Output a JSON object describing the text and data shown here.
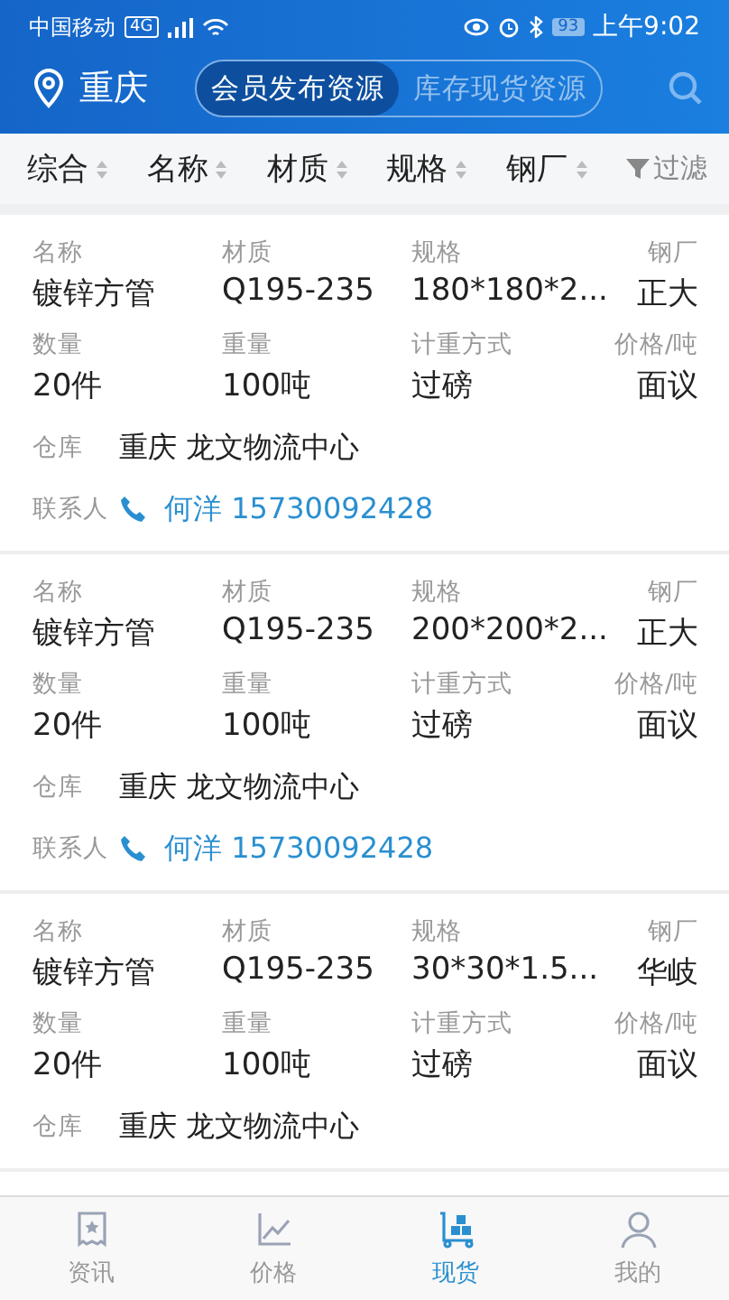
{
  "status_bar": {
    "carrier": "中国移动",
    "network": "4G",
    "battery": "93",
    "time": "上午9:02"
  },
  "header": {
    "city": "重庆",
    "segments": [
      {
        "label": "会员发布资源",
        "selected": true
      },
      {
        "label": "库存现货资源",
        "selected": false
      }
    ]
  },
  "sort_bar": {
    "items": [
      {
        "label": "综合"
      },
      {
        "label": "名称"
      },
      {
        "label": "材质"
      },
      {
        "label": "规格"
      },
      {
        "label": "钢厂"
      }
    ],
    "filter": "过滤"
  },
  "listings": [
    {
      "fields": [
        {
          "label": "名称",
          "value": "镀锌方管"
        },
        {
          "label": "材质",
          "value": "Q195-235"
        },
        {
          "label": "规格",
          "value": "180*180*2..."
        },
        {
          "label": "钢厂",
          "value": "正大"
        },
        {
          "label": "数量",
          "value": "20件"
        },
        {
          "label": "重量",
          "value": "100吨"
        },
        {
          "label": "计重方式",
          "value": "过磅"
        },
        {
          "label": "价格/吨",
          "value": "面议"
        }
      ],
      "warehouse_label": "仓库",
      "warehouse": "重庆 龙文物流中心",
      "contact_label": "联系人",
      "contact": "何洋 15730092428"
    },
    {
      "fields": [
        {
          "label": "名称",
          "value": "镀锌方管"
        },
        {
          "label": "材质",
          "value": "Q195-235"
        },
        {
          "label": "规格",
          "value": "200*200*2..."
        },
        {
          "label": "钢厂",
          "value": "正大"
        },
        {
          "label": "数量",
          "value": "20件"
        },
        {
          "label": "重量",
          "value": "100吨"
        },
        {
          "label": "计重方式",
          "value": "过磅"
        },
        {
          "label": "价格/吨",
          "value": "面议"
        }
      ],
      "warehouse_label": "仓库",
      "warehouse": "重庆 龙文物流中心",
      "contact_label": "联系人",
      "contact": "何洋 15730092428"
    },
    {
      "fields": [
        {
          "label": "名称",
          "value": "镀锌方管"
        },
        {
          "label": "材质",
          "value": "Q195-235"
        },
        {
          "label": "规格",
          "value": "30*30*1.5..."
        },
        {
          "label": "钢厂",
          "value": "华岐"
        },
        {
          "label": "数量",
          "value": "20件"
        },
        {
          "label": "重量",
          "value": "100吨"
        },
        {
          "label": "计重方式",
          "value": "过磅"
        },
        {
          "label": "价格/吨",
          "value": "面议"
        }
      ],
      "warehouse_label": "仓库",
      "warehouse": "重庆 龙文物流中心"
    }
  ],
  "tab_bar": [
    {
      "label": "资讯",
      "kind": "news",
      "selected": false
    },
    {
      "label": "价格",
      "kind": "chart",
      "selected": false
    },
    {
      "label": "现货",
      "kind": "stock",
      "selected": true
    },
    {
      "label": "我的",
      "kind": "user",
      "selected": false
    }
  ]
}
